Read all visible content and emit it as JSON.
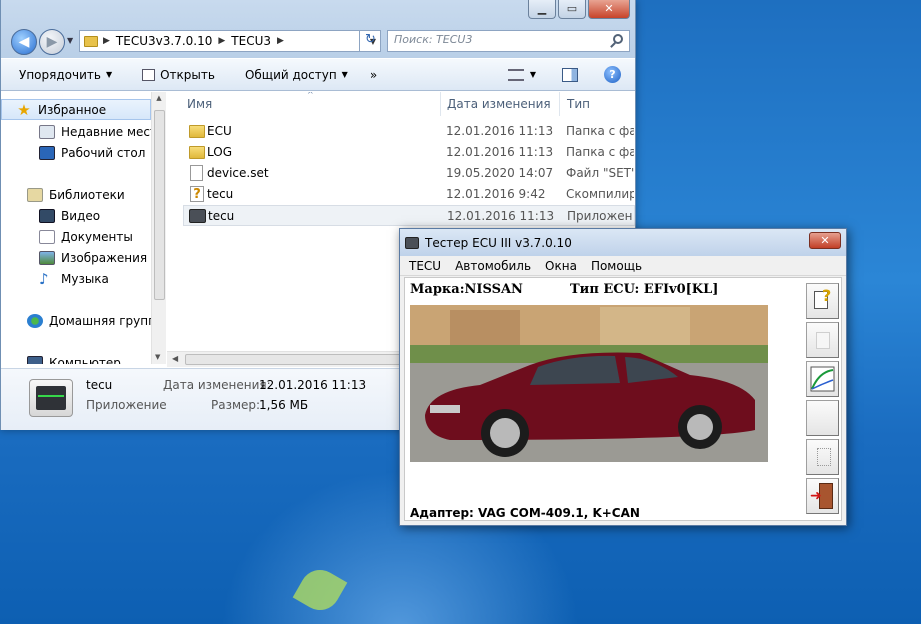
{
  "explorer": {
    "breadcrumb": [
      "TECU3v3.7.0.10",
      "TECU3"
    ],
    "search_placeholder": "Поиск: TECU3",
    "toolbar": {
      "organize": "Упорядочить",
      "open": "Открыть",
      "share": "Общий доступ",
      "more": "»"
    },
    "nav": {
      "favorites": "Избранное",
      "recent": "Недавние места",
      "desktop": "Рабочий стол",
      "libraries": "Библиотеки",
      "video": "Видео",
      "documents": "Документы",
      "images": "Изображения",
      "music": "Музыка",
      "homegroup": "Домашняя группа",
      "computer": "Компьютер"
    },
    "columns": {
      "name": "Имя",
      "date": "Дата изменения",
      "type": "Тип"
    },
    "files": [
      {
        "name": "ECU",
        "date": "12.01.2016 11:13",
        "type": "Папка с фай",
        "icon": "folder-icon"
      },
      {
        "name": "LOG",
        "date": "12.01.2016 11:13",
        "type": "Папка с фай",
        "icon": "folder-icon"
      },
      {
        "name": "device.set",
        "date": "19.05.2020 14:07",
        "type": "Файл \"SET\"",
        "icon": "document-icon"
      },
      {
        "name": "tecu",
        "date": "12.01.2016 9:42",
        "type": "Скомпилир",
        "icon": "help-file-icon"
      },
      {
        "name": "tecu",
        "date": "12.01.2016 11:13",
        "type": "Приложен",
        "icon": "app-icon"
      }
    ],
    "details": {
      "name": "tecu",
      "kind": "Приложение",
      "date_label": "Дата изменения:",
      "date_value": "12.01.2016 11:13",
      "size_label": "Размер:",
      "size_value": "1,56 МБ"
    }
  },
  "tester": {
    "title": "Тестер ECU III v3.7.0.10",
    "menu": [
      "TECU",
      "Автомобиль",
      "Окна",
      "Помощь"
    ],
    "make": "Марка:NISSAN",
    "ecu_type": "Тип ECU: EFIv0[KL]",
    "adapter": "Адаптер: VAG COM-409.1, K+CAN",
    "side_buttons": [
      "help-document-icon",
      "blank-button",
      "chart-icon",
      "blank-button",
      "page-icon",
      "exit-door-icon"
    ]
  },
  "colors": {
    "desktop": "#1e6fc0",
    "selection": "#d7e7fa",
    "close": "#c7432a"
  }
}
